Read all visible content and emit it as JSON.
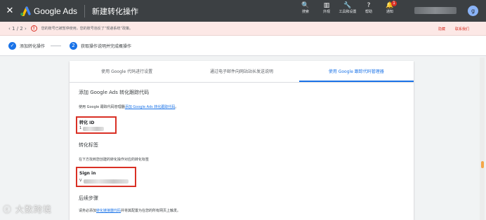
{
  "header": {
    "close_label": "✕",
    "brand": "Google Ads",
    "page_title": "新建转化操作",
    "tools": [
      {
        "icon": "search-icon",
        "glyph": "🔍",
        "label": "搜索"
      },
      {
        "icon": "appearance-icon",
        "glyph": "▥",
        "label": "外观"
      },
      {
        "icon": "wrench-icon",
        "glyph": "🔧",
        "label": "工具和设置"
      },
      {
        "icon": "help-icon",
        "glyph": "?",
        "label": "帮助"
      },
      {
        "icon": "bell-icon",
        "glyph": "🔔",
        "label": "通知",
        "badge": "1"
      }
    ],
    "avatar_initial": "g"
  },
  "alert": {
    "pager": "‹ 1 / 2 ›",
    "message": "您的账号已被暂停使用，您的账号违反了“规避系统”政策。",
    "hide_label": "隐藏",
    "contact_label": "联系我们",
    "accent": "#d93025"
  },
  "stepper": {
    "step1_label": "添加转化操作",
    "step2_number": "2",
    "step2_label": "获取操作说明并完成概操作"
  },
  "tabs": [
    "使用 Google 代码进行设置",
    "通过电子邮件向网站站长发送说明",
    "使用 Google 跟踪代码管理器"
  ],
  "content": {
    "section_add_title": "添加 Google Ads 转化跟踪代码",
    "instr_prefix": "使用 Google 跟踪代码管理器",
    "instr_link": "添加 Google Ads 转化跟踪代码",
    "instr_suffix": "。",
    "conversion_id_label": "转化 ID",
    "conversion_id_prefix": "1",
    "section_label_title": "转化标签",
    "label_desc": "在下方找到您创建的转化操作对应的转化标签",
    "label_name": "Sign in",
    "label_value_prefix": "V",
    "next_steps_title": "后续步骤",
    "next_prefix": "请务必添加",
    "next_link": "转化链接器代码",
    "next_suffix": "并将其配置为在您的所有网页上触发。"
  },
  "watermark": "大数跨境",
  "colors": {
    "primary": "#1a73e8",
    "header_bg": "#3c4043",
    "highlight": "#d93025"
  }
}
